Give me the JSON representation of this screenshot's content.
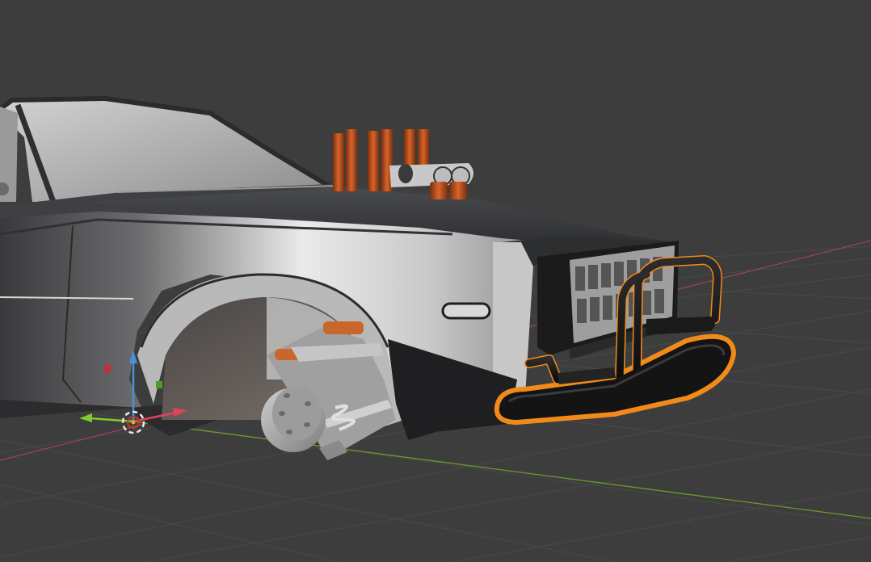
{
  "viewport": {
    "background_color": "#3d3d3d",
    "grid_color": "#494949",
    "x_axis_color": "#9b4452",
    "y_axis_color": "#6a9a2c",
    "selection_outline_color": "#f28a1a"
  },
  "scene": {
    "objects": [
      "car-body",
      "windshield",
      "blower-engine",
      "front-wheel-hub",
      "front-grille",
      "bull-bar-bumper"
    ],
    "selected_object": "bull-bar-bumper",
    "blower_color": "#c4531d"
  },
  "gizmo": {
    "icon": "transform-gizmo",
    "axes": [
      {
        "name": "z-axis",
        "color": "#4a8fe0",
        "direction": "up"
      },
      {
        "name": "x-axis",
        "color": "#e0435a",
        "direction": "right"
      },
      {
        "name": "y-axis",
        "color": "#7fcc2c",
        "direction": "left"
      }
    ],
    "pivot_icon": "3d-cursor-icon"
  }
}
